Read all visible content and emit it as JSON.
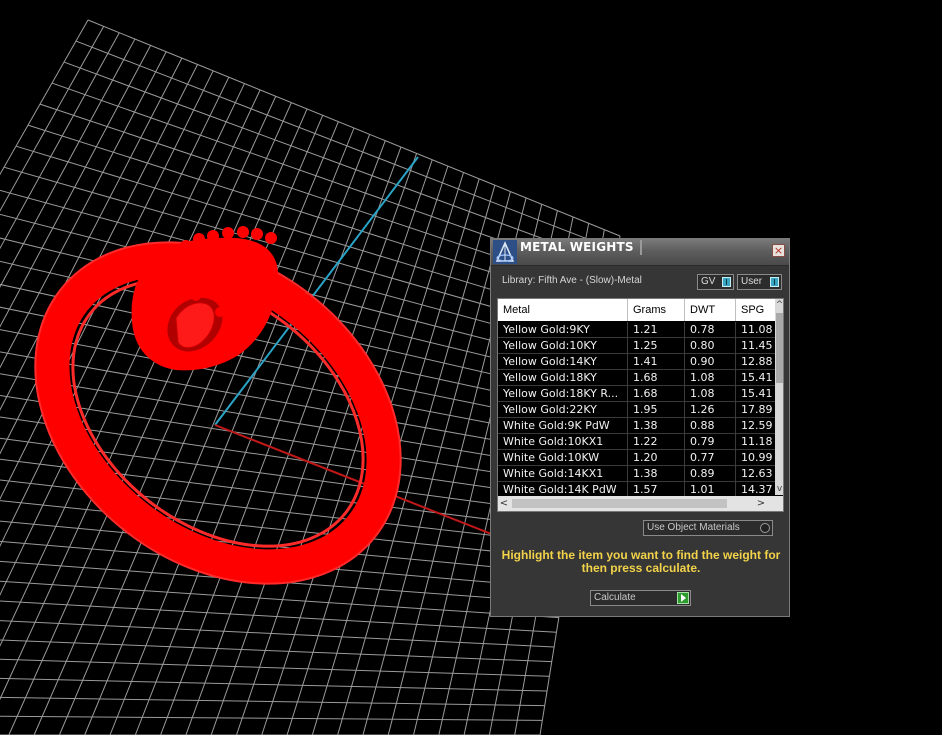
{
  "dialog": {
    "title": "METAL WEIGHTS",
    "close_glyph": "×",
    "library_label": "Library: Fifth Ave - (Slow)-Metal",
    "gv_select": "GV",
    "user_select": "User",
    "use_object_materials": "Use Object Materials",
    "hint": "Highlight the item you want to find the weight for then press calculate.",
    "calculate_label": "Calculate"
  },
  "table": {
    "headers": [
      "Metal",
      "Grams",
      "DWT",
      "SPG"
    ],
    "rows": [
      [
        "Yellow Gold:9KY",
        "1.21",
        "0.78",
        "11.08"
      ],
      [
        "Yellow Gold:10KY",
        "1.25",
        "0.80",
        "11.45"
      ],
      [
        "Yellow Gold:14KY",
        "1.41",
        "0.90",
        "12.88"
      ],
      [
        "Yellow Gold:18KY",
        "1.68",
        "1.08",
        "15.41"
      ],
      [
        "Yellow Gold:18KY R...",
        "1.68",
        "1.08",
        "15.41"
      ],
      [
        "Yellow Gold:22KY",
        "1.95",
        "1.26",
        "17.89"
      ],
      [
        "White Gold:9K PdW",
        "1.38",
        "0.88",
        "12.59"
      ],
      [
        "White Gold:10KX1",
        "1.22",
        "0.79",
        "11.18"
      ],
      [
        "White Gold:10KW",
        "1.20",
        "0.77",
        "10.99"
      ],
      [
        "White Gold:14KX1",
        "1.38",
        "0.89",
        "12.63"
      ],
      [
        "White Gold:14K PdW",
        "1.57",
        "1.01",
        "14.37"
      ]
    ]
  },
  "scroll": {
    "up": "^",
    "down": "v",
    "left": "<",
    "right": ">"
  },
  "colors": {
    "model": "#ff0000",
    "grid": "#cfcfcf",
    "axis_x": "#e02020",
    "axis_y": "#29a3c6",
    "hint_text": "#f2d34a"
  },
  "icons": [
    "app-logo-icon",
    "close-icon",
    "dropdown-tick-icon",
    "radio-icon",
    "play-arrow-icon"
  ]
}
